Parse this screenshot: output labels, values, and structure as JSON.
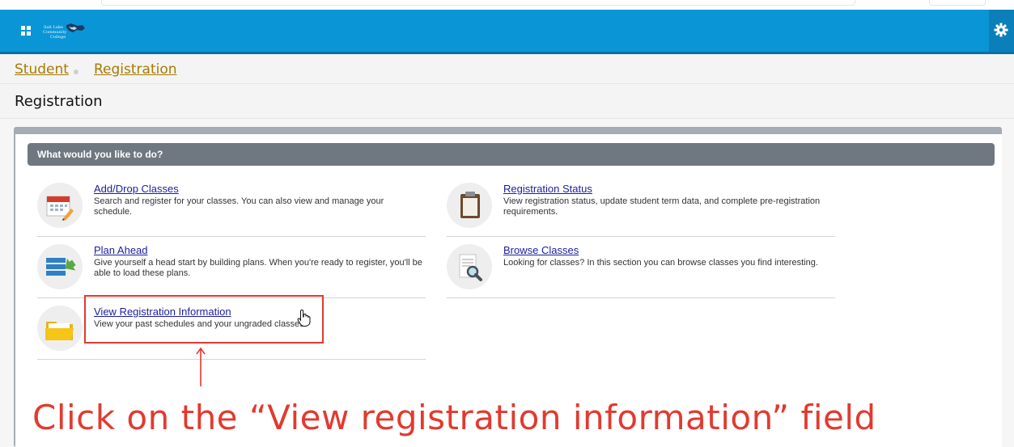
{
  "header": {
    "logo_text": "Salt Lake Community College"
  },
  "breadcrumb": {
    "items": [
      "Student",
      "Registration"
    ]
  },
  "page": {
    "title": "Registration"
  },
  "panel": {
    "heading": "What would you like to do?",
    "items": [
      {
        "title": "Add/Drop Classes",
        "description": "Search and register for your classes. You can also view and manage your schedule.",
        "icon": "calendar-icon"
      },
      {
        "title": "Registration Status",
        "description": "View registration status, update student term data, and complete pre-registration requirements.",
        "icon": "clipboard-icon"
      },
      {
        "title": "Plan Ahead",
        "description": "Give yourself a head start by building plans. When you're ready to register, you'll be able to load these plans.",
        "icon": "plan-list-icon"
      },
      {
        "title": "Browse Classes",
        "description": "Looking for classes? In this section you can browse classes you find interesting.",
        "icon": "magnifier-document-icon"
      },
      {
        "title": "View Registration Information",
        "description": "View your past schedules and your ungraded classes.",
        "icon": "folder-icon"
      }
    ]
  },
  "annotation": {
    "instruction": "Click on the “View registration information” field",
    "color": "#e23a2f"
  },
  "colors": {
    "header": "#0a96d6",
    "breadcrumb_link": "#a97a00",
    "panel_header": "#6f7880",
    "item_link": "#1a1e9e"
  }
}
